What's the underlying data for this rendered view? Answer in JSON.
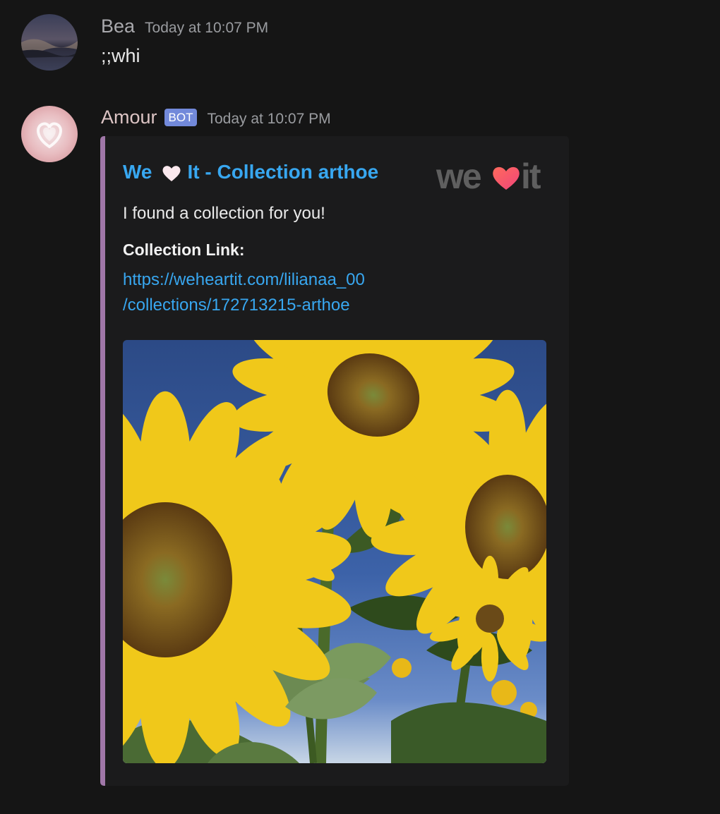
{
  "messages": [
    {
      "username": "Bea",
      "timestamp": "Today at 10:07 PM",
      "content": ";;whi"
    },
    {
      "username": "Amour",
      "bot_tag": "BOT",
      "timestamp": "Today at 10:07 PM",
      "embed": {
        "title_prefix": "We",
        "title_suffix": "It - Collection arthoe",
        "thumbnail_text_left": "we",
        "thumbnail_text_right": "it",
        "description": "I found a collection for you!",
        "field_name": "Collection Link:",
        "field_value_line1": "https://weheartit.com/lilianaa_00",
        "field_value_line2": "/collections/172713215-arthoe",
        "image": "sunflowers-photo",
        "accent_color": "#a077a8"
      }
    }
  ],
  "colors": {
    "background": "#151515",
    "link": "#38a7f0",
    "bot_tag": "#7289da"
  },
  "icons": [
    "heart-icon",
    "weheartit-logo"
  ]
}
